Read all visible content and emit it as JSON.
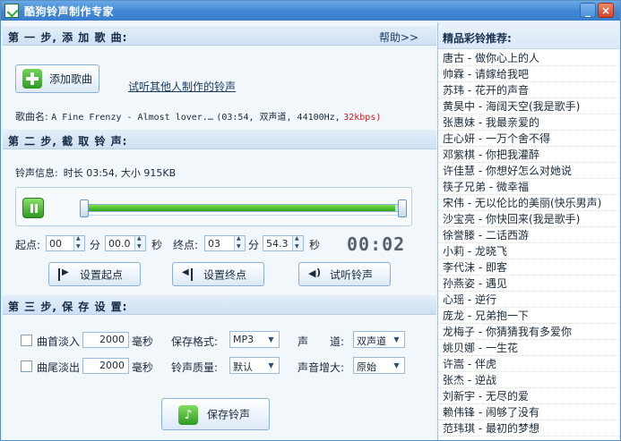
{
  "window": {
    "title": "酷狗铃声制作专家",
    "minimize_label": "_",
    "close_label": "×"
  },
  "step1": {
    "title": "第 一 步, 添 加 歌 曲:",
    "help_link": "帮助>>",
    "add_song_button": "添加歌曲",
    "listen_others_link": "试听其他人制作的铃声",
    "song_name_label": "歌曲名:",
    "song_name_value": "A Fine Frenzy - Almost lover.…",
    "song_meta": "(03:54, 双声道, 44100Hz,",
    "bitrate": "32kbps)"
  },
  "step2": {
    "title": "第 二 步, 截 取 铃 声:",
    "info_label": "铃声信息:",
    "info_value": "时长 03:54, 大小  915KB",
    "progress_fraction": 0.97,
    "start_label": "起点:",
    "start_min": "00",
    "start_sec": "00.0",
    "minute_unit": "分",
    "second_unit": "秒",
    "end_label": "终点:",
    "end_min": "03",
    "end_sec": "54.3",
    "elapsed_display": "00:02",
    "set_start_button": "设置起点",
    "set_end_button": "设置终点",
    "preview_button": "试听铃声"
  },
  "step3": {
    "title": "第 三 步, 保 存 设 置:",
    "fade_in_label": "曲首淡入",
    "fade_in_value": "2000",
    "fade_out_label": "曲尾淡出",
    "fade_out_value": "2000",
    "ms_unit": "毫秒",
    "format_label": "保存格式:",
    "format_value": "MP3",
    "quality_label": "铃声质量:",
    "quality_value": "默认",
    "channel_label": "声　　道:",
    "channel_value": "双声道",
    "volume_label": "声音增大:",
    "volume_value": "原始",
    "save_button": "保存铃声"
  },
  "recommend": {
    "title": "精品彩铃推荐:",
    "items": [
      "唐古 - 做你心上的人",
      "帅霖 - 请嫁给我吧",
      "苏玮 - 花开的声音",
      "黄昊中 - 海阔天空(我是歌手)",
      "张惠妹 - 我最亲爱的",
      "庄心妍 - 一万个舍不得",
      "邓紫棋 - 你把我灌醉",
      "许佳慧 - 你想好怎么对她说",
      "筷子兄弟 - 微幸福",
      "宋伟 - 无以伦比的美丽(快乐男声)",
      "沙宝亮 - 你快回来(我是歌手)",
      "徐誉滕 - 二话西游",
      "小莉 - 龙晓飞",
      "李代沫 - 即客",
      "孙燕姿 - 遇见",
      "心瑶 - 逆行",
      "庞龙 - 兄弟抱一下",
      "龙梅子 - 你猜猜我有多爱你",
      "姚贝娜 - 一生花",
      "许嵩 - 伴虎",
      "张杰 - 逆战",
      "刘新宇 - 无尽的爱",
      "赖伟锋 - 闹够了没有",
      "范玮琪 - 最初的梦想"
    ]
  }
}
